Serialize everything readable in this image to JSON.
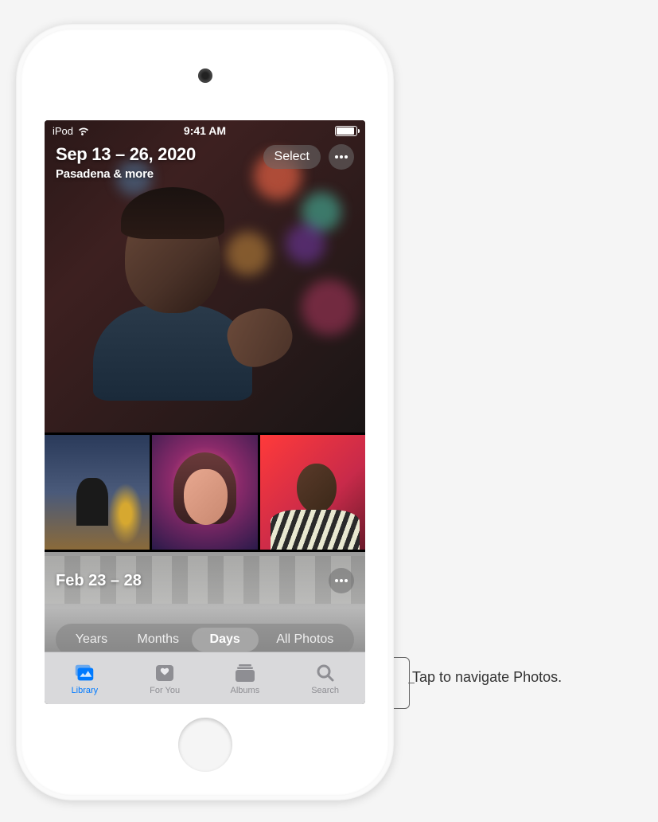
{
  "status_bar": {
    "carrier": "iPod",
    "time": "9:41 AM"
  },
  "hero": {
    "date_range": "Sep 13 – 26, 2020",
    "location": "Pasadena & more",
    "select_label": "Select"
  },
  "second_section": {
    "date_range": "Feb 23 – 28"
  },
  "view_segments": {
    "years": "Years",
    "months": "Months",
    "days": "Days",
    "all_photos": "All Photos"
  },
  "tabs": {
    "library": "Library",
    "for_you": "For You",
    "albums": "Albums",
    "search": "Search"
  },
  "callout": "Tap to navigate Photos."
}
